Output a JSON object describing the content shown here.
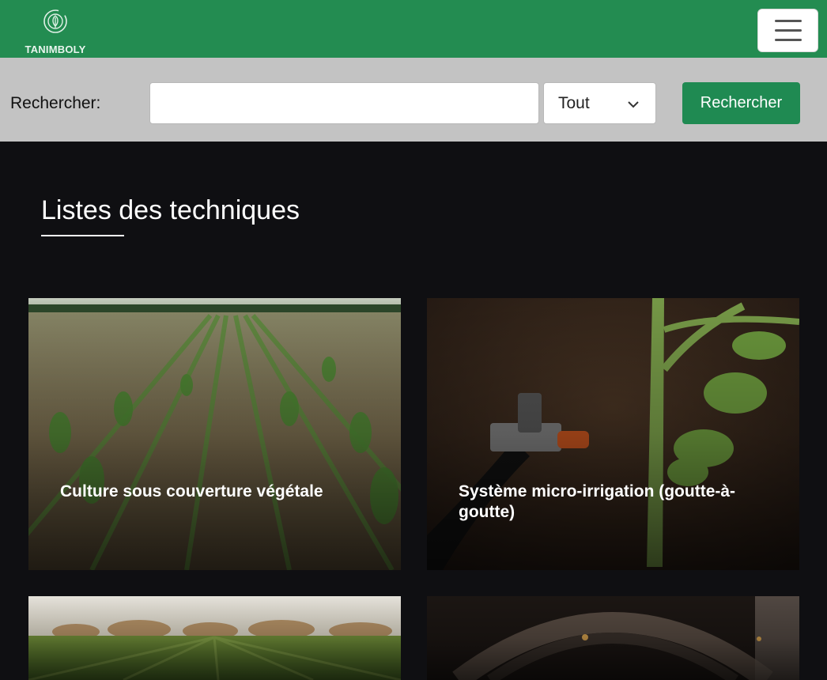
{
  "header": {
    "brand_name": "TANIMBOLY",
    "logo_icon": "leaf-circle-icon",
    "menu_icon": "hamburger-menu-icon",
    "colors": {
      "bar": "#238c51",
      "button": "#1f8a52"
    }
  },
  "search": {
    "label": "Rechercher:",
    "input_value": "",
    "input_placeholder": "",
    "select_value": "Tout",
    "button_label": "Rechercher"
  },
  "main": {
    "section_title": "Listes des techniques",
    "cards": [
      {
        "title": "Culture sous couverture végétale",
        "image": "cornfield-mulch-photo"
      },
      {
        "title": "Système micro-irrigation (goutte-à-goutte)",
        "image": "drip-irrigation-tomato-photo"
      },
      {
        "title": "",
        "image": "wheat-field-photo"
      },
      {
        "title": "",
        "image": "stone-cellar-photo"
      }
    ]
  }
}
